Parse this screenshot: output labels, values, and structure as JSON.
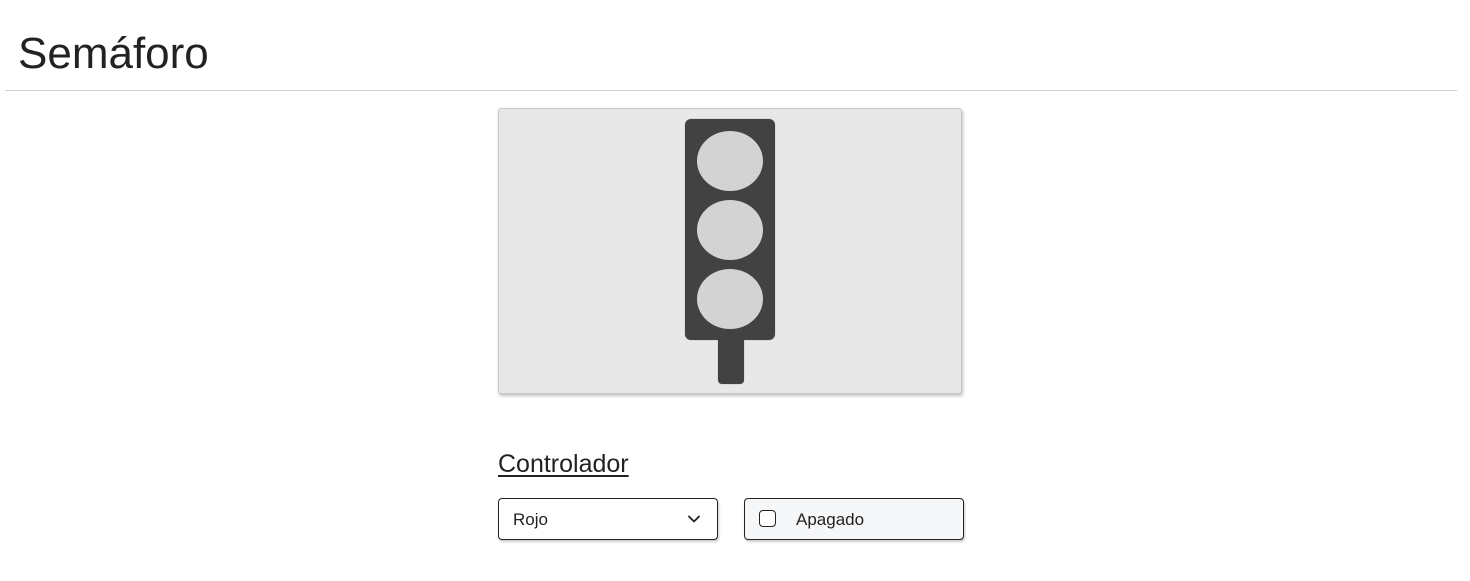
{
  "page": {
    "title": "Semáforo"
  },
  "traffic_light": {
    "lamps": [
      {
        "name": "red",
        "state": "off",
        "color": "#d3d3d3"
      },
      {
        "name": "yellow",
        "state": "off",
        "color": "#d3d3d3"
      },
      {
        "name": "green",
        "state": "off",
        "color": "#d3d3d3"
      }
    ],
    "housing_color": "#424242",
    "panel_color": "#e8e8e8"
  },
  "controller": {
    "heading": "Controlador",
    "color_select": {
      "selected": "Rojo",
      "icon": "chevron-down-icon"
    },
    "power_toggle": {
      "label": "Apagado",
      "checked": false
    }
  }
}
